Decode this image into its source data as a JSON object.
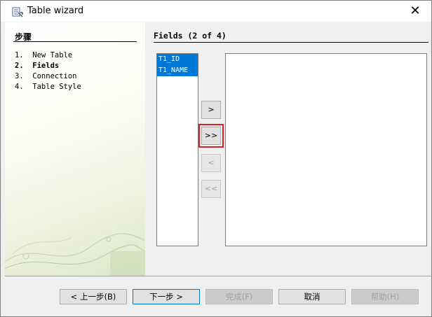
{
  "window": {
    "title": "Table wizard",
    "close_glyph": "✕"
  },
  "steps": {
    "header": "步骤",
    "items": [
      "1.  New Table",
      "2.  Fields",
      "3.  Connection",
      "4.  Table Style"
    ],
    "current_index": 1
  },
  "fields_panel": {
    "title": "Fields (2 of 4)",
    "available": [
      "T1_ID",
      "T1_NAME"
    ],
    "selected": []
  },
  "move_buttons": {
    "add_one": ">",
    "add_all": ">>",
    "remove_one": "<",
    "remove_all": "<<"
  },
  "footer": {
    "back": "< 上一步(B)",
    "next": "下一步 >",
    "finish": "完成(F)",
    "cancel": "取消",
    "help": "帮助(H)"
  },
  "colors": {
    "selection": "#0078d7",
    "focus_outline": "#e02020"
  }
}
